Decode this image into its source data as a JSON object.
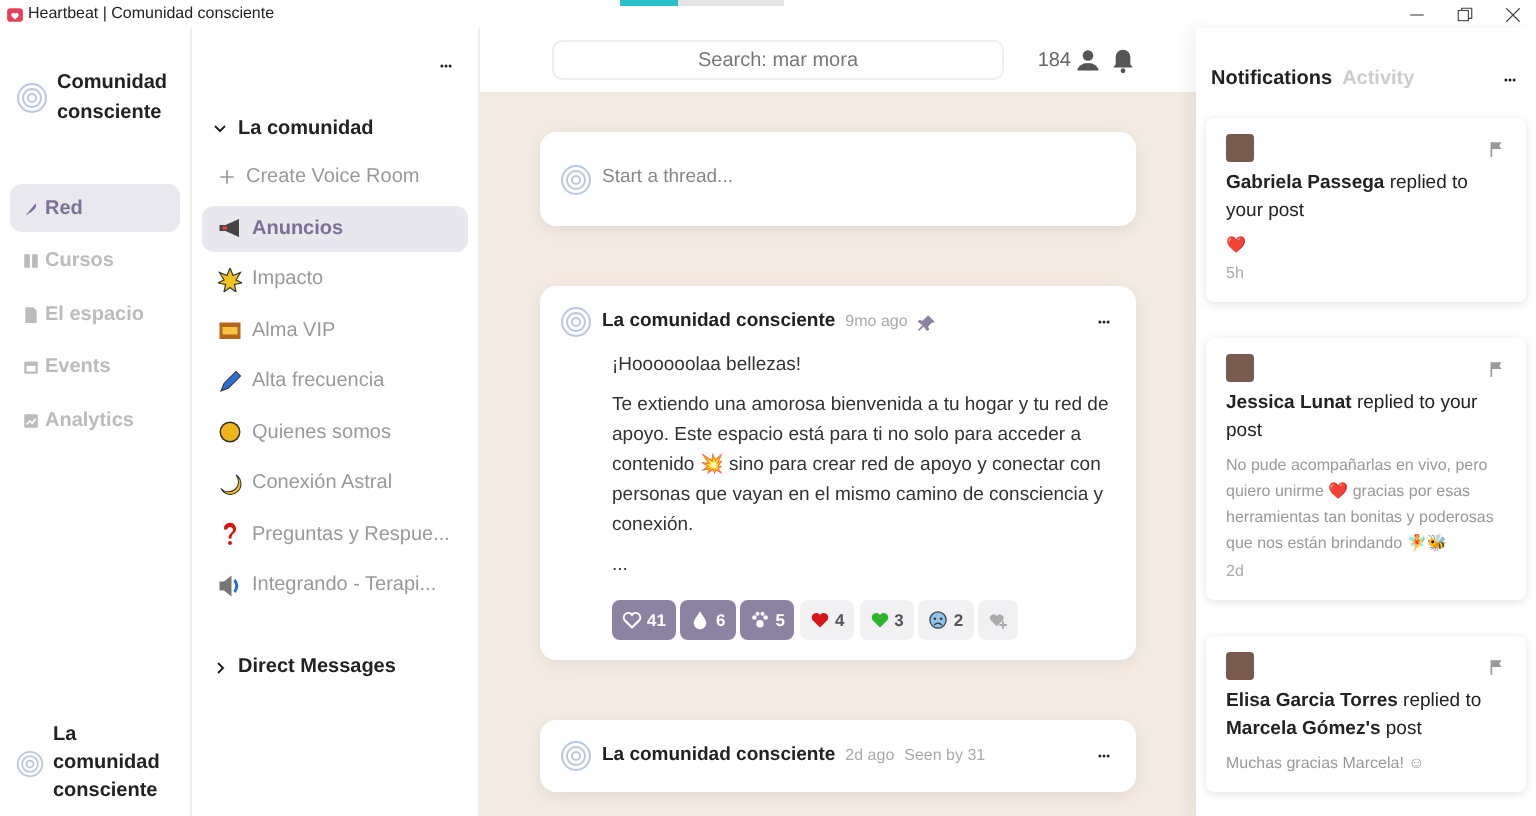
{
  "window": {
    "title": "Heartbeat | Comunidad consciente",
    "loading_bar": {
      "level": 0.35
    }
  },
  "community": {
    "name": "Comunidad consciente",
    "footer_name": "La comunidad consciente"
  },
  "nav": [
    {
      "label": "Red",
      "selected": true
    },
    {
      "label": "Cursos",
      "selected": false
    },
    {
      "label": "El espacio",
      "selected": false
    },
    {
      "label": "Events",
      "selected": false
    },
    {
      "label": "Analytics",
      "selected": false
    }
  ],
  "channels": {
    "group": "La comunidad",
    "expanded": true,
    "create": "Create Voice Room",
    "items": [
      {
        "label": "Anuncios",
        "selected": true
      },
      {
        "label": "Impacto",
        "selected": false
      },
      {
        "label": "Alma VIP",
        "selected": false
      },
      {
        "label": "Alta frecuencia",
        "selected": false
      },
      {
        "label": "Quienes somos",
        "selected": false
      },
      {
        "label": "Conexión Astral",
        "selected": false
      },
      {
        "label": "Preguntas y Respue...",
        "selected": false
      },
      {
        "label": "Integrando - Terapi...",
        "selected": false
      }
    ],
    "dm": {
      "label": "Direct Messages",
      "expanded": false
    }
  },
  "header": {
    "search_placeholder": "Search: mar mora",
    "member_count": "184"
  },
  "composer": {
    "placeholder": "Start a thread..."
  },
  "posts": [
    {
      "author": "La comunidad consciente",
      "time": "9mo ago",
      "pinned": true,
      "body": [
        "¡Hoooooolaa bellezas!",
        "Te extiendo una amorosa bienvenida a tu hogar y tu red de apoyo. Este espacio está para ti no solo para acceder a contenido 💥 sino para crear red de apoyo y conectar con personas que vayan en el mismo camino de consciencia y conexión.",
        "..."
      ],
      "reactions": [
        {
          "count": "41",
          "selected": true
        },
        {
          "count": "6",
          "selected": true
        },
        {
          "count": "5",
          "selected": true
        },
        {
          "count": "4",
          "selected": false
        },
        {
          "count": "3",
          "selected": false
        },
        {
          "count": "2",
          "selected": false
        }
      ]
    },
    {
      "author": "La comunidad consciente",
      "time": "2d ago",
      "seen": "Seen by 31",
      "pinned": false
    }
  ],
  "panel": {
    "tabs": [
      {
        "label": "Notifications",
        "selected": true
      },
      {
        "label": "Activity",
        "selected": false
      }
    ],
    "notifications": [
      {
        "name": "Gabriela Passega",
        "action": "replied to your post",
        "message": "❤️",
        "time": "5h"
      },
      {
        "name": "Jessica Lunat",
        "action": "replied to your post",
        "message": "No pude acompañarlas en vivo, pero quiero unirme ❤️ gracias por esas herramientas tan bonitas y poderosas que nos están brindando 🧚🐝",
        "time": "2d"
      },
      {
        "name": "Elisa Garcia Torres",
        "action": "replied to",
        "target": "Marcela Gómez's",
        "tail": "post",
        "message": "Muchas gracias Marcela! ☺"
      }
    ]
  }
}
